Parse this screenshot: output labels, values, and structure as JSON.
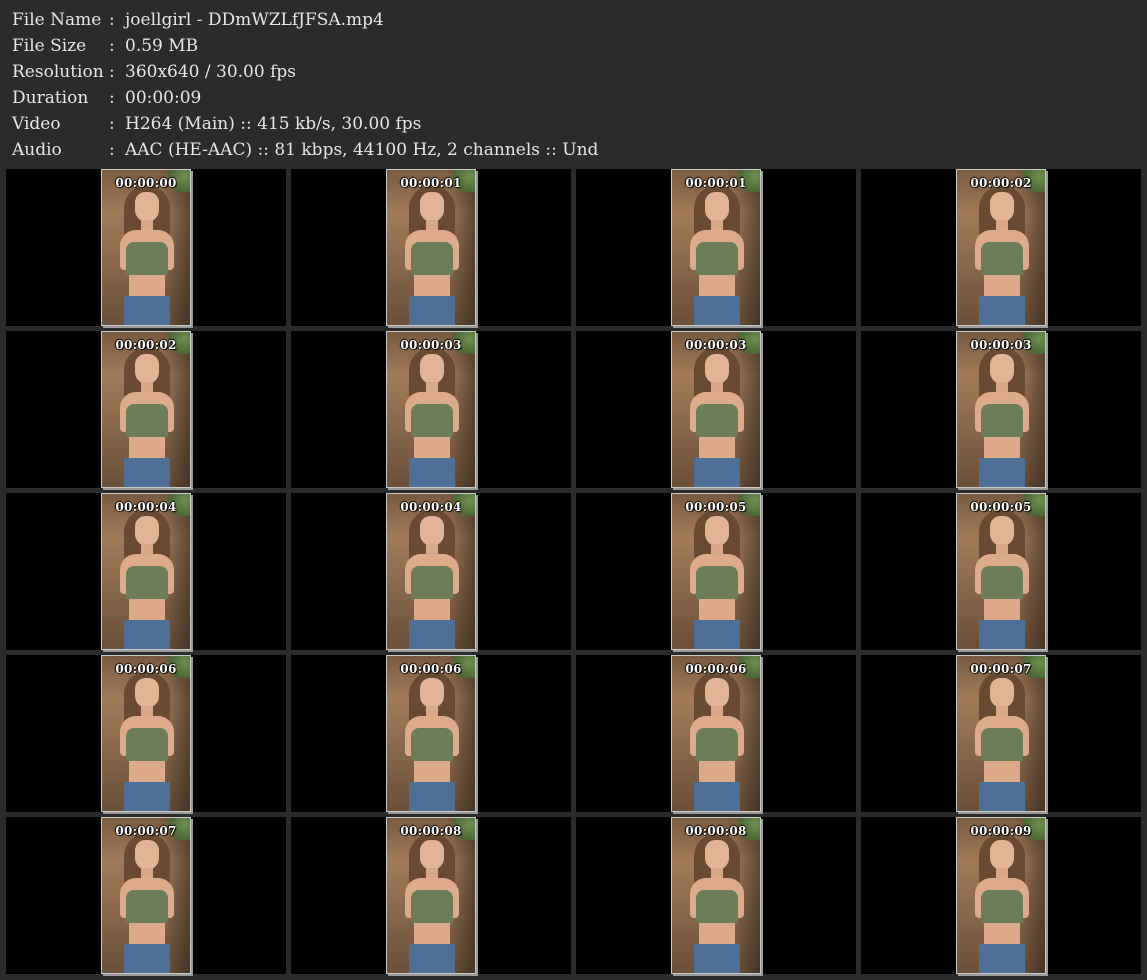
{
  "info": [
    {
      "label": "File Name",
      "sep": ":",
      "value": "joellgirl - DDmWZLfJFSA.mp4"
    },
    {
      "label": "File Size",
      "sep": ":",
      "value": "0.59 MB"
    },
    {
      "label": "Resolution",
      "sep": ":",
      "value": "360x640 / 30.00 fps"
    },
    {
      "label": "Duration",
      "sep": ":",
      "value": "00:00:09"
    },
    {
      "label": "Video",
      "sep": ":",
      "value": "H264 (Main) :: 415 kb/s, 30.00 fps"
    },
    {
      "label": "Audio",
      "sep": ":",
      "value": "AAC (HE-AAC) :: 81 kbps, 44100 Hz, 2 channels :: Und"
    }
  ],
  "thumbnails": [
    "00:00:00",
    "00:00:01",
    "00:00:01",
    "00:00:02",
    "00:00:02",
    "00:00:03",
    "00:00:03",
    "00:00:03",
    "00:00:04",
    "00:00:04",
    "00:00:05",
    "00:00:05",
    "00:00:06",
    "00:00:06",
    "00:00:06",
    "00:00:07",
    "00:00:07",
    "00:00:08",
    "00:00:08",
    "00:00:09"
  ],
  "colors": {
    "background": "#2b2b2b",
    "cell": "#000000",
    "text": "#e6e6e6"
  }
}
